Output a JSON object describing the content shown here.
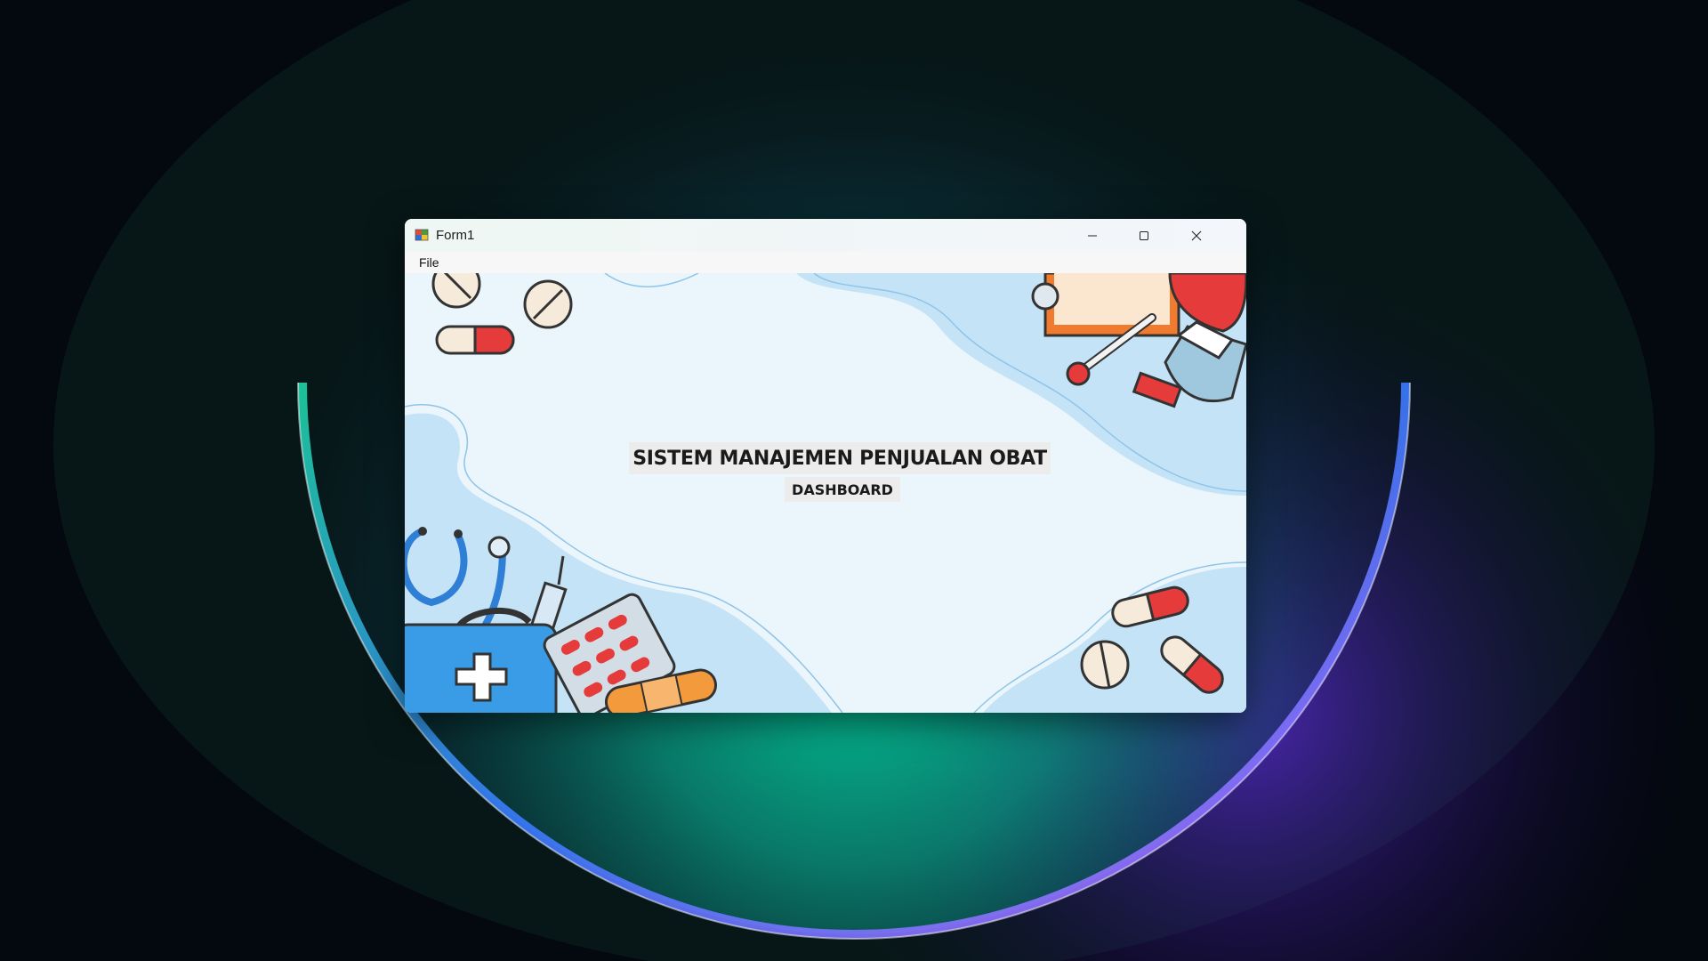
{
  "window": {
    "title": "Form1",
    "app_icon": "winforms-app-icon"
  },
  "caption_buttons": {
    "minimize_icon": "minimize-icon",
    "maximize_icon": "maximize-icon",
    "close_icon": "close-icon"
  },
  "menu": {
    "items": [
      {
        "label": "File"
      }
    ]
  },
  "content": {
    "title": "SISTEM MANAJEMEN PENJUALAN OBAT",
    "subtitle": "DASHBOARD"
  },
  "colors": {
    "client_background": "#eaf5fc",
    "accent_blue": "#3b9be3",
    "pill_red": "#e53b3b",
    "label_background": "#ececec"
  }
}
